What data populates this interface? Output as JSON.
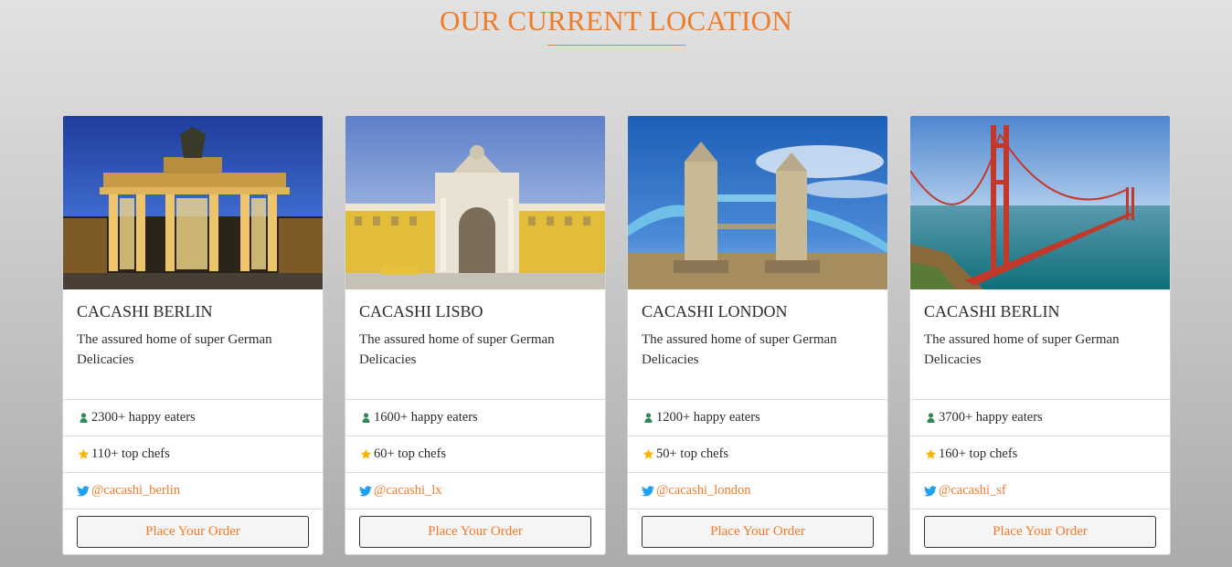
{
  "section": {
    "title": "OUR CURRENT LOCATION"
  },
  "colors": {
    "accent": "#f07c2a",
    "person_icon": "#2e8b57",
    "star_icon": "#f5b50a",
    "twitter_icon": "#1da1f2"
  },
  "cards": [
    {
      "title": "CACASHI BERLIN",
      "description": "The assured home of super German Delicacies",
      "eaters": "2300+ happy eaters",
      "chefs": "110+ top chefs",
      "twitter": "@cacashi_berlin",
      "button": "Place Your Order",
      "image": "brandenburg-gate-photo"
    },
    {
      "title": "CACASHI LISBO",
      "description": "The assured home of super German Delicacies",
      "eaters": "1600+ happy eaters",
      "chefs": "60+ top chefs",
      "twitter": "@cacashi_lx",
      "button": "Place Your Order",
      "image": "lisbon-arch-photo"
    },
    {
      "title": "CACASHI LONDON",
      "description": "The assured home of super German Delicacies",
      "eaters": "1200+ happy eaters",
      "chefs": "50+ top chefs",
      "twitter": "@cacashi_london",
      "button": "Place Your Order",
      "image": "tower-bridge-photo"
    },
    {
      "title": "CACASHI BERLIN",
      "description": "The assured home of super German Delicacies",
      "eaters": "3700+ happy eaters",
      "chefs": "160+ top chefs",
      "twitter": "@cacashi_sf",
      "button": "Place Your Order",
      "image": "golden-gate-bridge-photo"
    }
  ]
}
